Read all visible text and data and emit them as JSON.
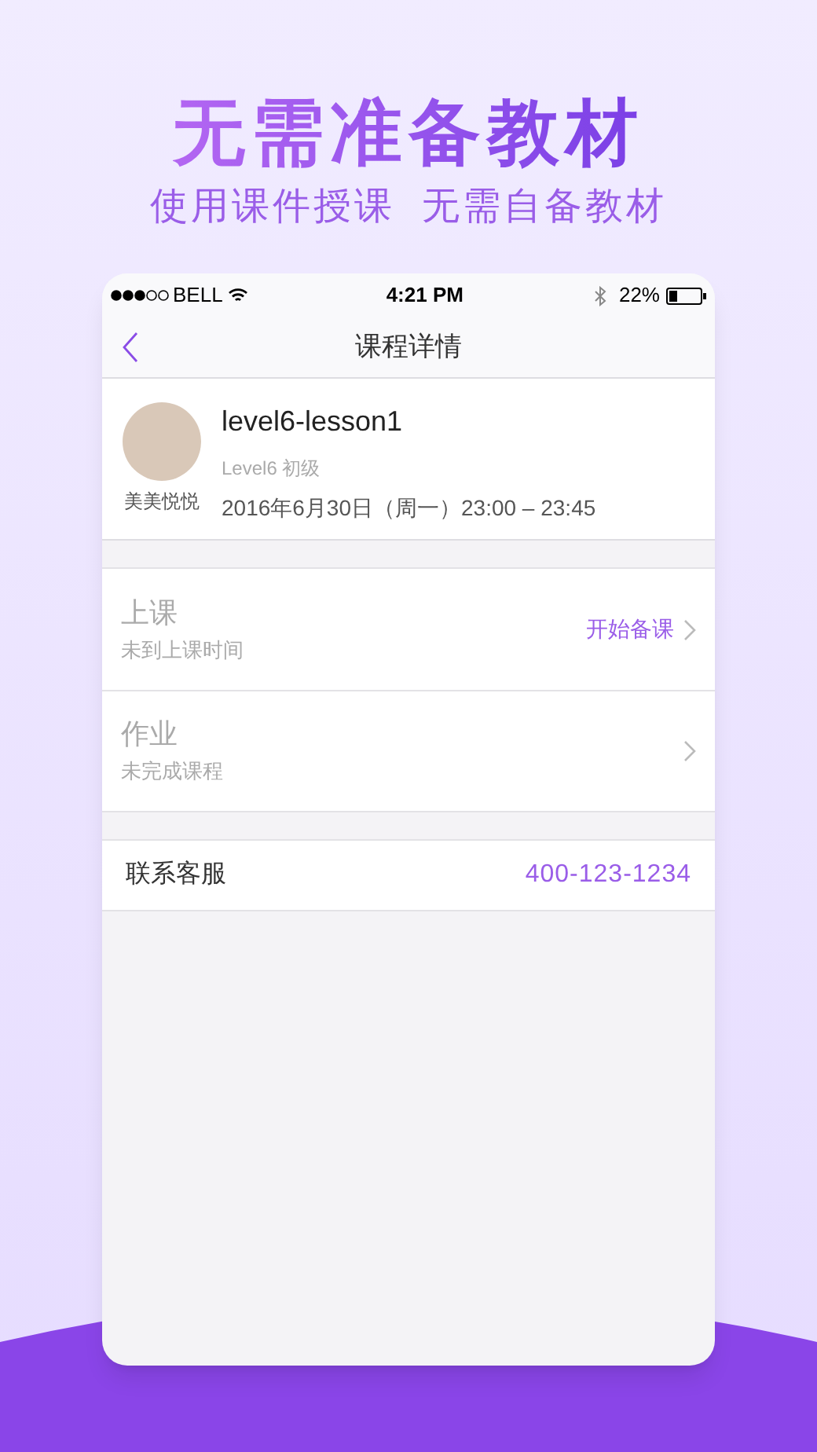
{
  "headline": "无需准备教材",
  "subheadline": "使用课件授课  无需自备教材",
  "status_bar": {
    "carrier": "BELL",
    "time": "4:21 PM",
    "battery": "22%"
  },
  "nav": {
    "title": "课程详情"
  },
  "course": {
    "teacher": "美美悦悦",
    "title": "level6-lesson1",
    "level": "Level6 初级",
    "schedule": "2016年6月30日（周一）23:00 – 23:45"
  },
  "sections": [
    {
      "title": "上课",
      "subtitle": "未到上课时间",
      "action": "开始备课",
      "disabled": true
    },
    {
      "title": "作业",
      "subtitle": "未完成课程",
      "disabled": true
    }
  ],
  "contact": {
    "label": "联系客服",
    "phone": "400-123-1234"
  }
}
